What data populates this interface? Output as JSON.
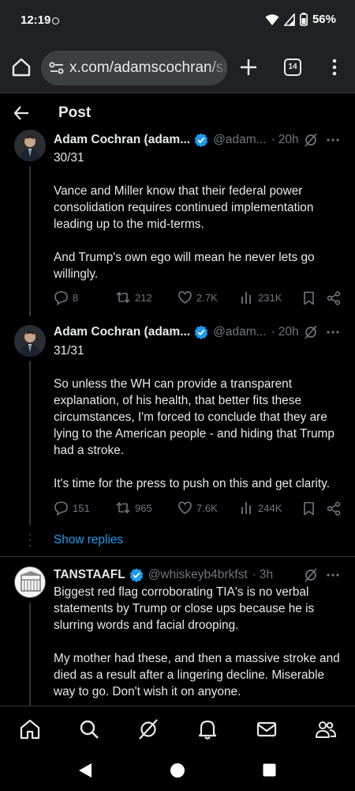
{
  "status_bar": {
    "time": "12:19",
    "battery": "56%"
  },
  "browser": {
    "url": "x.com/adamscochran/sta",
    "tab_count": "14"
  },
  "header": {
    "title": "Post"
  },
  "tweets": [
    {
      "name": "Adam Cochran (adam...",
      "handle": "@adam...",
      "time": "20h",
      "text": "30/31\n\nVance and Miller know that their federal power consolidation requires continued implementation leading up to the mid-terms.\n\nAnd Trump's own ego will mean he never lets go willingly.",
      "replies": "8",
      "reposts": "212",
      "likes": "2.7K",
      "views": "231K"
    },
    {
      "name": "Adam Cochran (adam...",
      "handle": "@adam...",
      "time": "20h",
      "text": "31/31\n\nSo unless the WH can provide a transparent explanation, of his health, that better fits these circumstances, I'm forced to conclude that they are lying to the American people - and hiding that Trump had a stroke.\n\nIt's time for the press to push on this and get clarity.",
      "replies": "151",
      "reposts": "965",
      "likes": "7.6K",
      "views": "244K"
    },
    {
      "name": "TANSTAAFL",
      "handle": "@whiskeyb4brkfst",
      "time": "3h",
      "text": "Biggest red flag corroborating TIA's is no verbal statements by Trump or close ups because he is slurring words and facial drooping.\n\nMy mother had these, and then a massive stroke and died as a result after a lingering decline. Miserable way to go. Don't wish it on anyone."
    }
  ],
  "show_replies": "Show replies",
  "nav": [
    "home-icon",
    "search-icon",
    "grok-icon",
    "notifications-icon",
    "messages-icon",
    "communities-icon"
  ],
  "colors": {
    "accent": "#1d9bf0",
    "background": "#000000",
    "muted": "#71767b"
  }
}
